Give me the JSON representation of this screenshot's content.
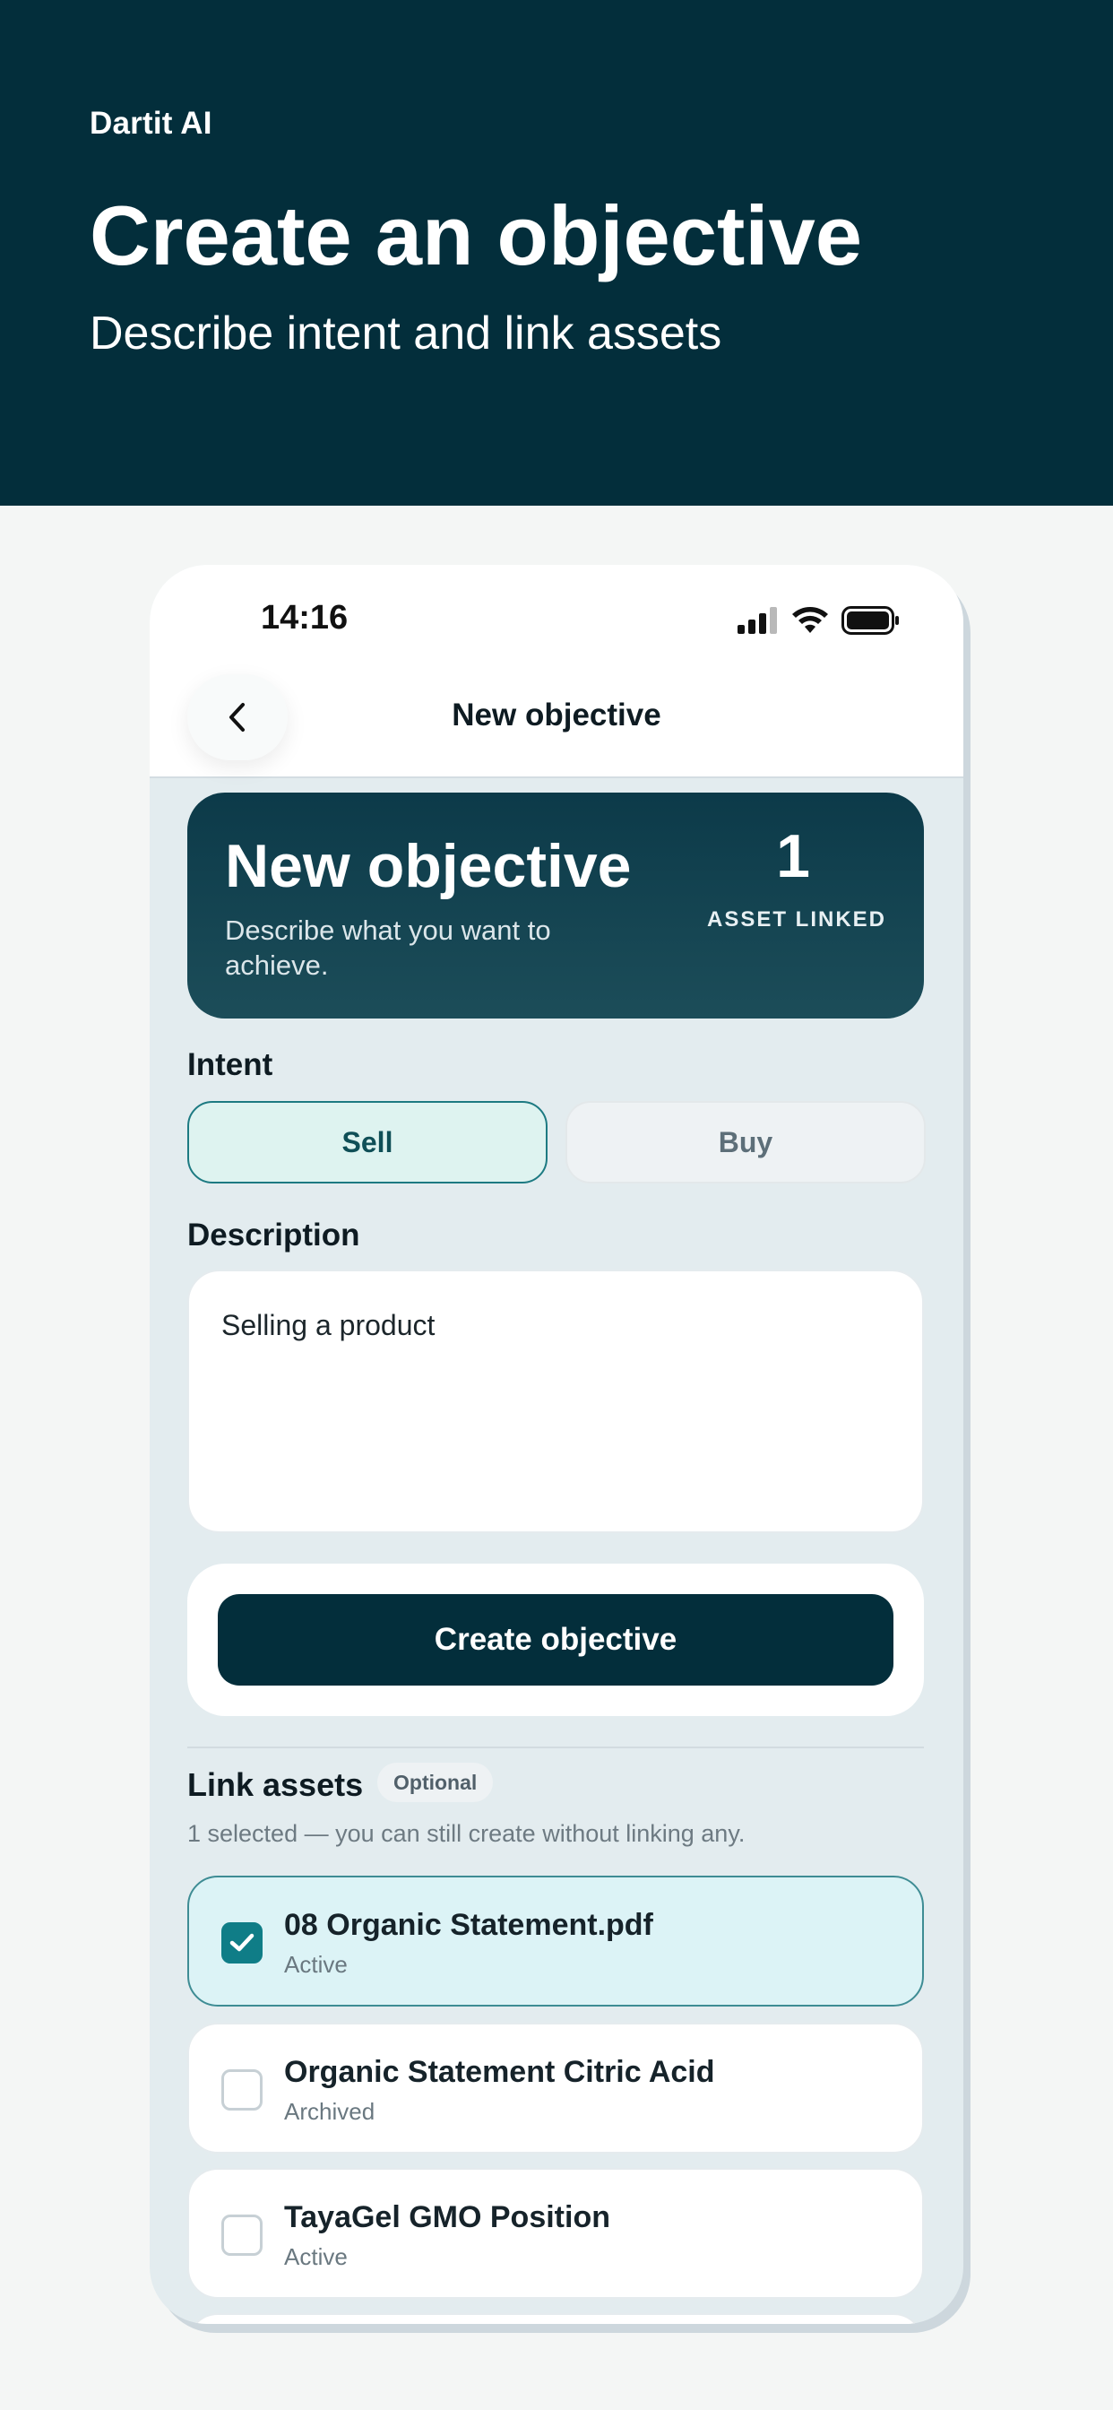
{
  "banner": {
    "brand": "Dartit AI",
    "headline": "Create an objective",
    "subline": "Describe intent and link assets"
  },
  "status_bar": {
    "time": "14:16",
    "icons": [
      "signal-icon",
      "wifi-icon",
      "battery-icon"
    ]
  },
  "nav": {
    "back_icon": "chevron-left-icon",
    "title": "New objective"
  },
  "hero": {
    "title": "New objective",
    "description": "Describe what you want to achieve.",
    "asset_count": "1",
    "asset_label": "ASSET LINKED"
  },
  "intent": {
    "label": "Intent",
    "options": [
      "Sell",
      "Buy"
    ],
    "selected": "Sell"
  },
  "description": {
    "label": "Description",
    "value": "Selling a product"
  },
  "create_button": "Create objective",
  "link_assets": {
    "title": "Link assets",
    "badge": "Optional",
    "helper": "1 selected — you can still create without linking any.",
    "items": [
      {
        "name": "08 Organic Statement.pdf",
        "status": "Active",
        "checked": true
      },
      {
        "name": "Organic Statement Citric Acid",
        "status": "Archived",
        "checked": false
      },
      {
        "name": "TayaGel GMO Position",
        "status": "Active",
        "checked": false
      }
    ]
  },
  "colors": {
    "banner_bg": "#032e3b",
    "accent_teal": "#0f7d87",
    "primary_button": "#032e3b"
  }
}
